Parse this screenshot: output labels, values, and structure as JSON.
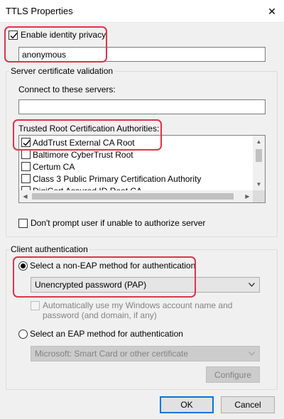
{
  "window": {
    "title": "TTLS Properties",
    "close_glyph": "✕"
  },
  "identity": {
    "enable_privacy_label": "Enable identity privacy",
    "enable_privacy_checked": true,
    "anonymous_value": "anonymous"
  },
  "server_validation": {
    "group_label": "Server certificate validation",
    "connect_label": "Connect to these servers:",
    "connect_value": "",
    "trusted_cas_label": "Trusted Root Certification Authorities:",
    "cas": [
      {
        "label": "AddTrust External CA Root",
        "checked": true
      },
      {
        "label": "Baltimore CyberTrust Root",
        "checked": false
      },
      {
        "label": "Certum CA",
        "checked": false
      },
      {
        "label": "Class 3 Public Primary Certification Authority",
        "checked": false
      },
      {
        "label": "DigiCert Assured ID Root CA",
        "checked": false
      }
    ],
    "dont_prompt_label": "Don't prompt user if unable to authorize server",
    "dont_prompt_checked": false
  },
  "client_auth": {
    "group_label": "Client authentication",
    "non_eap_label": "Select a non-EAP method for authentication",
    "non_eap_selected": true,
    "non_eap_method": "Unencrypted password (PAP)",
    "auto_use_line1": "Automatically use my Windows account name and",
    "auto_use_line2": "password (and domain, if any)",
    "eap_label": "Select an EAP method for authentication",
    "eap_method": "Microsoft: Smart Card or other certificate",
    "configure_label": "Configure"
  },
  "footer": {
    "ok_label": "OK",
    "cancel_label": "Cancel"
  },
  "colors": {
    "highlight": "#e0334a",
    "default_button_border": "#0078d7"
  },
  "icons": [
    "close-icon",
    "checkmark-icon",
    "chevron-down-icon",
    "scroll-up-icon",
    "scroll-down-icon",
    "scroll-left-icon",
    "scroll-right-icon"
  ]
}
